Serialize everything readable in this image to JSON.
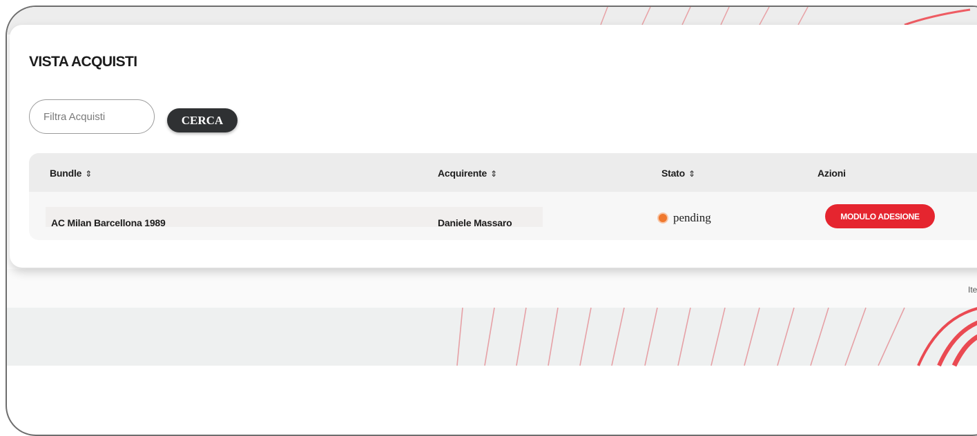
{
  "page": {
    "title": "VISTA ACQUISTI"
  },
  "search": {
    "placeholder": "Filtra Acquisti",
    "button_label": "CERCA"
  },
  "table": {
    "columns": [
      {
        "label": "Bundle",
        "sort_icon": "⌃⌄",
        "sortable": true
      },
      {
        "label": "Acquirente",
        "sort_icon": "⌃⌄",
        "sortable": true
      },
      {
        "label": "Stato",
        "sort_icon": "⌃⌄",
        "sortable": true
      },
      {
        "label": "Azioni",
        "sortable": false
      }
    ],
    "rows": [
      {
        "bundle": "AC Milan Barcellona 1989",
        "buyer": "Daniele Massaro",
        "status": "pending",
        "status_color": "#f0782e",
        "action_label": "MODULO ADESIONE"
      }
    ]
  },
  "pagination": {
    "items_label": "Iter"
  },
  "colors": {
    "accent": "#e5252f",
    "dark_button": "#2f3133"
  }
}
